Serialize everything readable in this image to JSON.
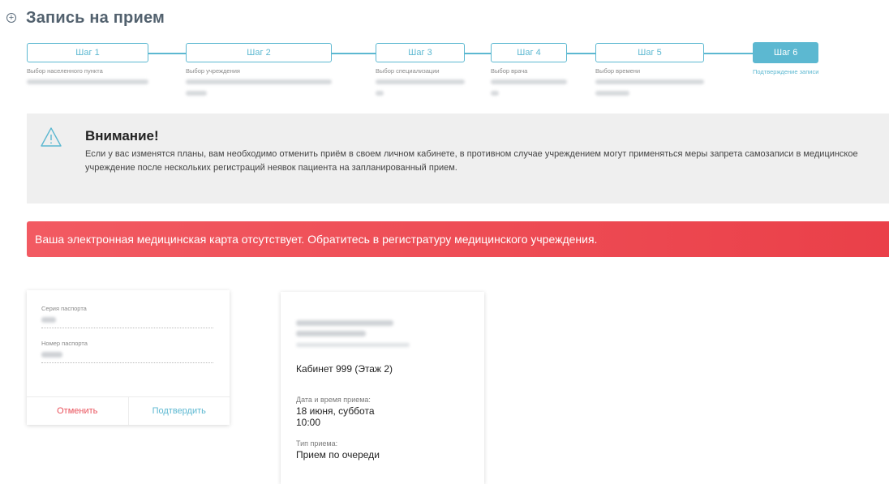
{
  "page": {
    "title": "Запись на прием"
  },
  "icons": {
    "header": "circle-plus-icon",
    "warning": "warning-triangle-icon"
  },
  "colors": {
    "accent": "#5cb8d1",
    "error": "#ea4049",
    "title": "#52616e"
  },
  "steps": [
    {
      "label": "Шаг 1",
      "title": "Выбор населенного пункта"
    },
    {
      "label": "Шаг 2",
      "title": "Выбор учреждения"
    },
    {
      "label": "Шаг 3",
      "title": "Выбор специализации"
    },
    {
      "label": "Шаг 4",
      "title": "Выбор врача"
    },
    {
      "label": "Шаг 5",
      "title": "Выбор времени"
    },
    {
      "label": "Шаг 6",
      "title": "Подтверждение записи"
    }
  ],
  "warning": {
    "title": "Внимание!",
    "text": "Если у вас изменятся планы, вам необходимо отменить приём в своем личном кабинете, в противном случае учреждением могут применяться меры запрета самозаписи в медицинское учреждение после нескольких регистраций неявок пациента на запланированный прием."
  },
  "error": {
    "text": "Ваша электронная медицинская карта отсутствует. Обратитесь в регистратуру медицинского учреждения."
  },
  "passport": {
    "series_label": "Серия паспорта",
    "number_label": "Номер паспорта",
    "cancel_label": "Отменить",
    "confirm_label": "Подтвердить"
  },
  "appointment": {
    "room": "Кабинет 999 (Этаж 2)",
    "datetime_label": "Дата и время приема:",
    "date": "18 июня, суббота",
    "time": "10:00",
    "type_label": "Тип приема:",
    "type": "Прием по очереди"
  }
}
